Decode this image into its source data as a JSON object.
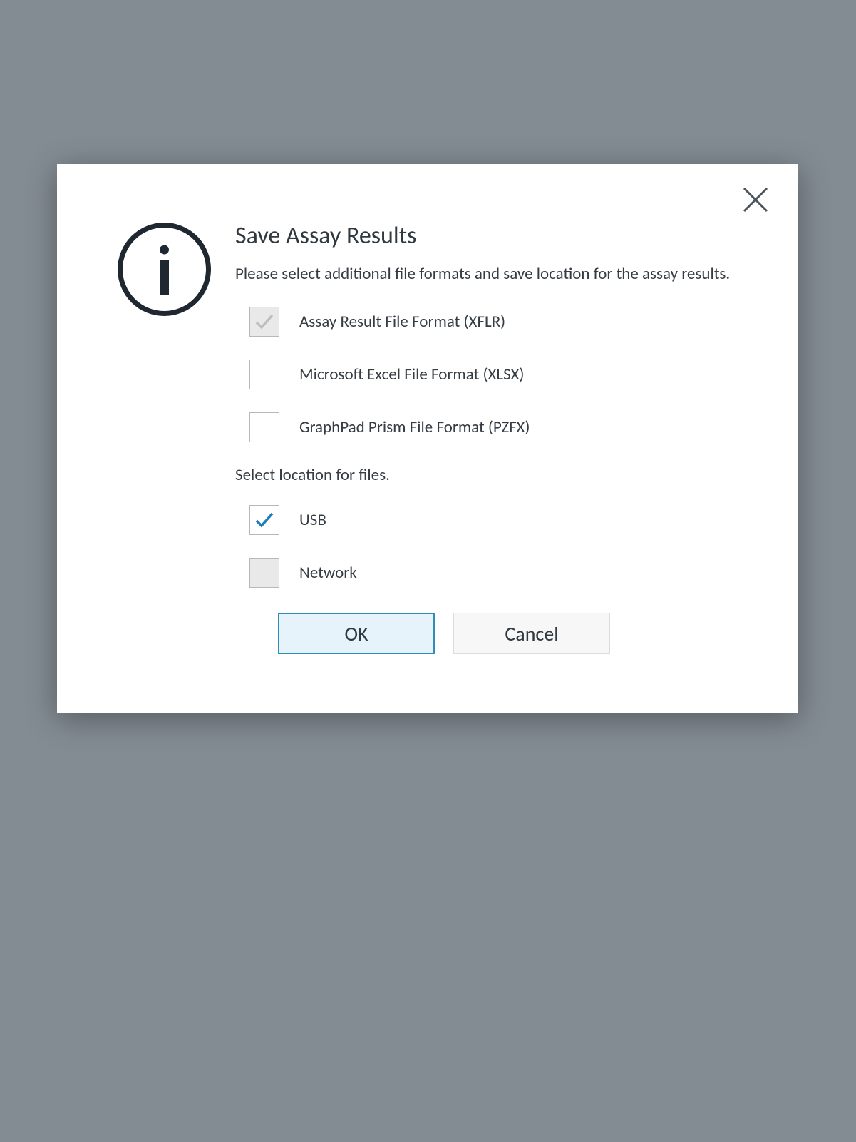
{
  "dialog": {
    "title": "Save Assay Results",
    "description": "Please select additional file formats and save location for the assay results.",
    "formats": [
      {
        "label": "Assay Result File Format (XFLR)",
        "checked": true,
        "disabled": true
      },
      {
        "label": "Microsoft Excel File Format (XLSX)",
        "checked": false,
        "disabled": false
      },
      {
        "label": "GraphPad Prism File Format (PZFX)",
        "checked": false,
        "disabled": false
      }
    ],
    "location_label": "Select location for files.",
    "locations": [
      {
        "label": "USB",
        "checked": true,
        "disabled": false
      },
      {
        "label": "Network",
        "checked": false,
        "disabled": true
      }
    ],
    "buttons": {
      "ok": "OK",
      "cancel": "Cancel"
    }
  },
  "colors": {
    "check_active": "#1e7fb5",
    "check_disabled": "#bfbfbf",
    "close_stroke": "#4a545c",
    "info_stroke": "#1f2730"
  }
}
